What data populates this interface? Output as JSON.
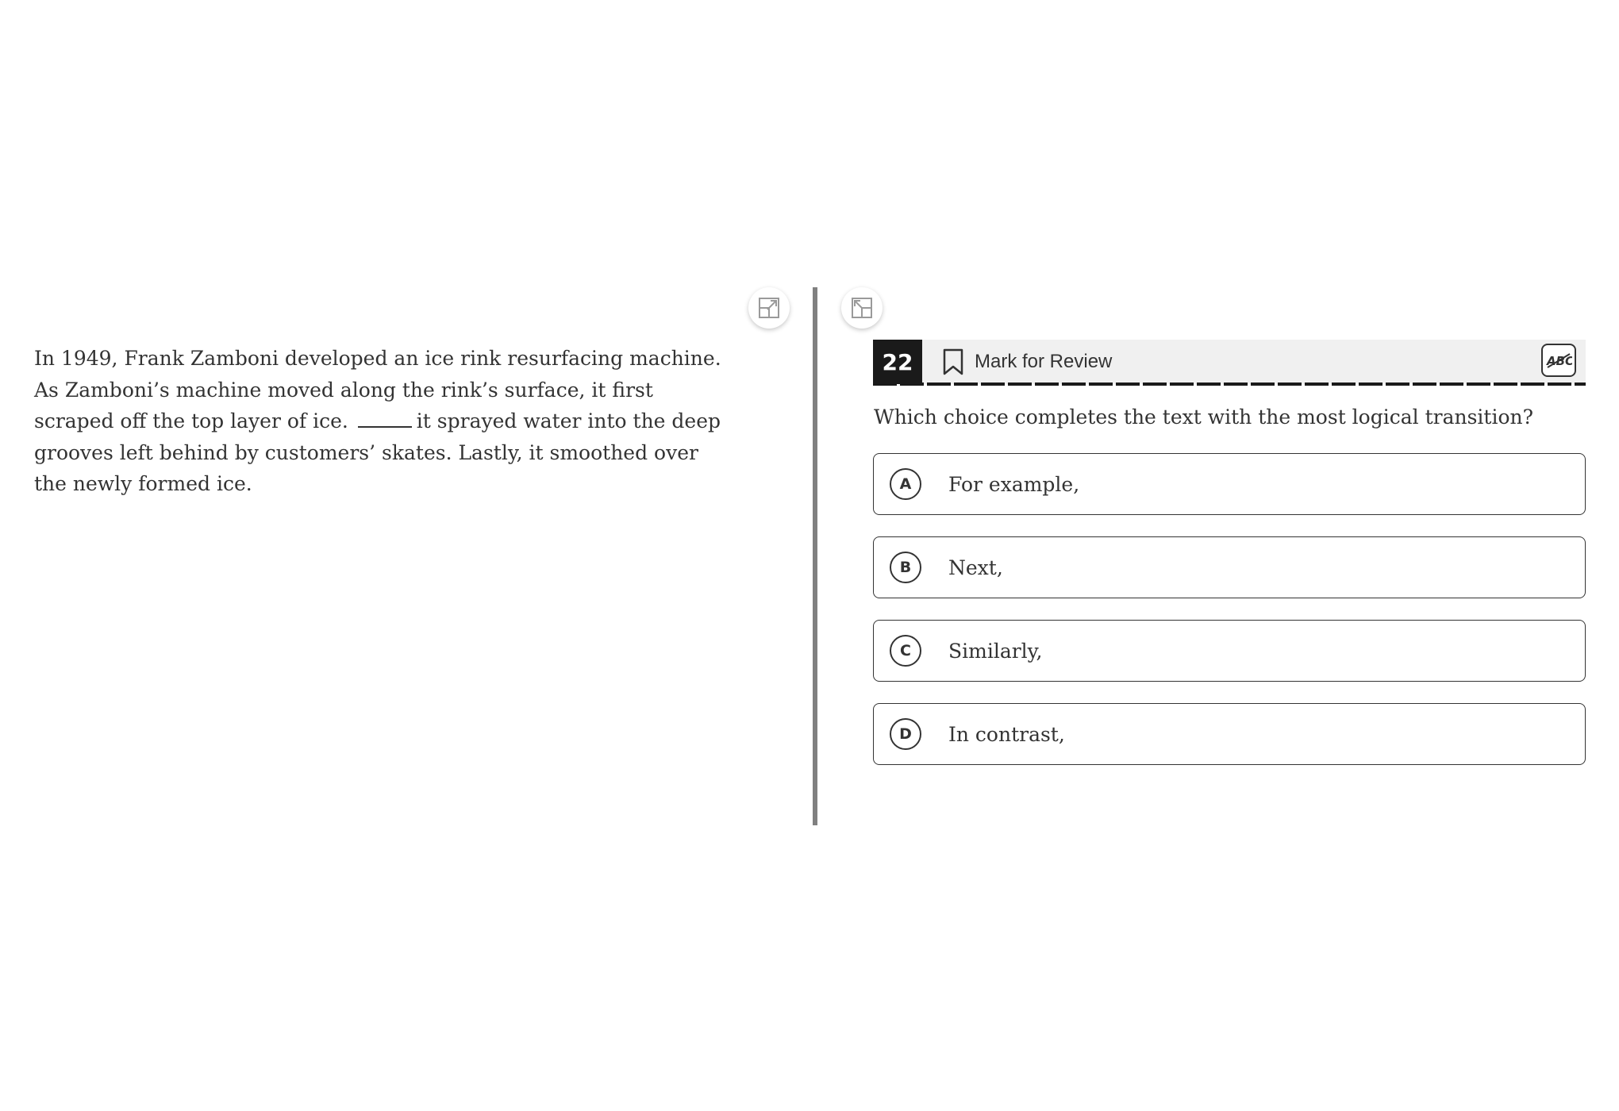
{
  "passage": {
    "text_before_blank": "In 1949, Frank Zamboni developed an ice rink resurfacing machine. As Zamboni’s machine moved along the rink’s surface, it first scraped off the top layer of ice.",
    "text_after_blank": "it sprayed water into the deep grooves left behind by customers’ skates. Lastly, it smoothed over the newly formed ice."
  },
  "pane_controls": {
    "left_icon": "expand-icon",
    "right_icon": "collapse-icon"
  },
  "question": {
    "number": "22",
    "mark_for_review_label": "Mark for Review",
    "bookmark_icon": "bookmark-icon",
    "eliminator_icon": "abc-strikethrough-icon",
    "prompt": "Which choice completes the text with the most logical transition?",
    "choices": [
      {
        "letter": "A",
        "text": "For example,"
      },
      {
        "letter": "B",
        "text": "Next,"
      },
      {
        "letter": "C",
        "text": "Similarly,"
      },
      {
        "letter": "D",
        "text": "In contrast,"
      }
    ]
  },
  "colors": {
    "header_bg": "#f0f0f0",
    "number_bg": "#1a1a1a",
    "divider": "#808080",
    "text": "#333333"
  }
}
